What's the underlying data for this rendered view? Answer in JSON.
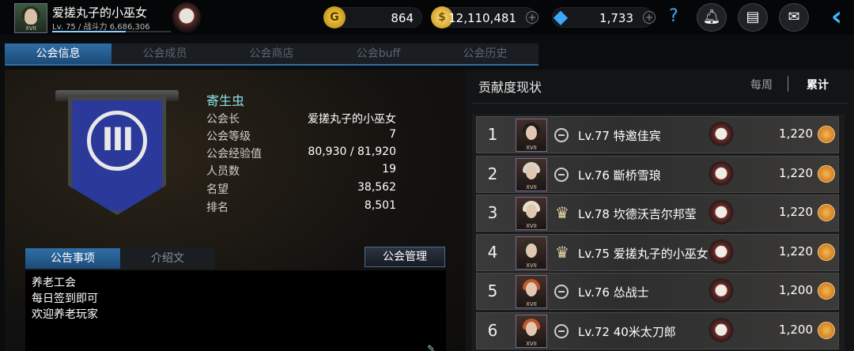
{
  "player": {
    "name": "爱搓丸子的小巫女",
    "level_text": "Lv. 75 / 战斗力 6,686,306",
    "rank_mark": "XVII"
  },
  "currencies": [
    {
      "icon": "gold-coin-g-icon",
      "symbol": "G",
      "value": "864"
    },
    {
      "icon": "gold-coin-icon",
      "symbol": "",
      "value": "12,110,481"
    },
    {
      "icon": "blue-diamond-icon",
      "symbol": "",
      "value": "1,733"
    }
  ],
  "tabs": [
    "公会信息",
    "公会成员",
    "公会商店",
    "公会buff",
    "公会历史"
  ],
  "guild": {
    "name": "寄生虫",
    "info": [
      {
        "label": "公会长",
        "value": "爱搓丸子的小巫女"
      },
      {
        "label": "公会等级",
        "value": "7"
      },
      {
        "label": "公会经验值",
        "value": "80,930 / 81,920"
      },
      {
        "label": "人员数",
        "value": "19"
      },
      {
        "label": "名望",
        "value": "38,562"
      },
      {
        "label": "排名",
        "value": "8,501"
      }
    ]
  },
  "subtabs": [
    "公告事项",
    "介绍文"
  ],
  "manage_button": "公会管理",
  "notice_lines": [
    "养老工会",
    "每日签到即可",
    "欢迎养老玩家"
  ],
  "contribution": {
    "title": "贡献度现状",
    "weekly": "每周",
    "total": "累计",
    "rows": [
      {
        "rank": "1",
        "name": "Lv.77 特邀佳宾",
        "score": "1,220",
        "badge": "class-icon",
        "hair": "#1e1b1a",
        "mark": "XVII"
      },
      {
        "rank": "2",
        "name": "Lv.76 斷桥雪琅",
        "score": "1,220",
        "badge": "class-icon",
        "hair": "#d8d4cc",
        "mark": "XVII"
      },
      {
        "rank": "3",
        "name": "Lv.78 坎德沃吉尔邦莹",
        "score": "1,220",
        "badge": "crown-icon",
        "hair": "#e8e0cc",
        "mark": "XVII"
      },
      {
        "rank": "4",
        "name": "Lv.75 爱搓丸子的小巫女",
        "score": "1,220",
        "badge": "crown-icon",
        "hair": "#2b2d24",
        "mark": "XVII"
      },
      {
        "rank": "5",
        "name": "Lv.76 怂战士",
        "score": "1,200",
        "badge": "class-icon",
        "hair": "#c0582a",
        "mark": "XVII"
      },
      {
        "rank": "6",
        "name": "Lv.72 40米太刀郎",
        "score": "1,200",
        "badge": "class-icon",
        "hair": "#c0582a",
        "mark": "XVII"
      }
    ]
  }
}
